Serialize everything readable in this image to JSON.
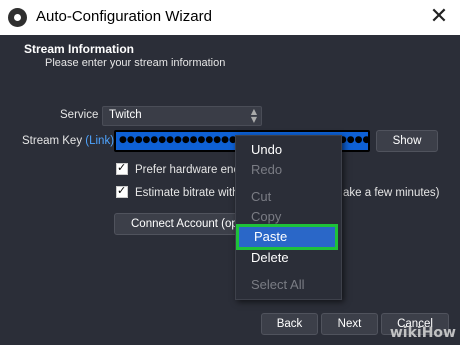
{
  "window": {
    "title": "Auto-Configuration Wizard",
    "close_glyph": "✕"
  },
  "header": {
    "heading": "Stream Information",
    "subheading": "Please enter your stream information"
  },
  "form": {
    "service_label": "Service",
    "service_value": "Twitch",
    "stream_key_label": "Stream Key",
    "stream_key_link": "(Link)",
    "stream_key_dots": "●●●●●●●●●●●●●●●●●●●●●●●●●●●●●●●●●●●●●●●●●●●●●●●●●●●●●",
    "show_button": "Show",
    "prefer_hw_label": "Prefer hardware enco",
    "estimate_bitrate_label": "Estimate bitrate with",
    "estimate_bitrate_suffix": "ake a few minutes)",
    "connect_account_label": "Connect Account (opt"
  },
  "footer": {
    "back": "Back",
    "next": "Next",
    "cancel": "Cancel"
  },
  "context_menu": {
    "items": [
      {
        "label": "Undo",
        "enabled": true
      },
      {
        "label": "Redo",
        "enabled": false
      },
      {
        "label": "Cut",
        "enabled": false
      },
      {
        "label": "Copy",
        "enabled": false
      },
      {
        "label": "Paste",
        "enabled": true,
        "highlighted": true
      },
      {
        "label": "Delete",
        "enabled": true
      },
      {
        "label": "Select All",
        "enabled": false
      }
    ]
  },
  "watermark": "wikiHow",
  "colors": {
    "background": "#2b2e38",
    "key_field": "#0e60d4",
    "menu_highlight": "#2a67c8",
    "highlight_outline": "#1ec23a",
    "link": "#4ea4ff"
  },
  "icons": [
    "obs-logo-icon",
    "close-icon",
    "spin-arrows-icon",
    "checkbox-checked-icon"
  ]
}
